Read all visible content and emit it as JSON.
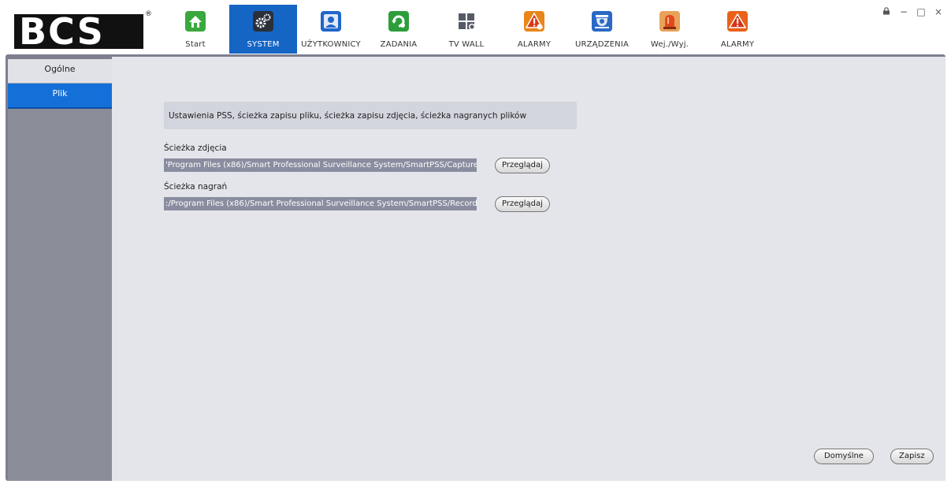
{
  "brand": {
    "logo_text": "BCS",
    "registered_mark": "®"
  },
  "nav": {
    "items": [
      {
        "label": "Start",
        "icon": "home-icon",
        "color": "#3aa83d"
      },
      {
        "label": "SYSTEM",
        "icon": "gear-icon",
        "color": "#2a2f3a"
      },
      {
        "label": "UŻYTKOWNICY",
        "icon": "user-icon",
        "color": "#1f66c9"
      },
      {
        "label": "ZADANIA",
        "icon": "tasks-icon",
        "color": "#2e9e3b"
      },
      {
        "label": "TV WALL",
        "icon": "tv-wall-icon",
        "color": "#555a66"
      },
      {
        "label": "ALARMY",
        "icon": "alarm-warning-icon",
        "color": "#e8861a"
      },
      {
        "label": "URZĄDZENIA",
        "icon": "camera-dome-icon",
        "color": "#2a69c4"
      },
      {
        "label": "Wej./Wyj.",
        "icon": "siren-icon",
        "color": "#e14a1e"
      },
      {
        "label": "ALARMY",
        "icon": "alarm-warning-icon",
        "color": "#e8621a"
      }
    ],
    "active_index": 1,
    "active_color": "#1565c5"
  },
  "window_controls": {
    "lock": "🔒",
    "minimize": "−",
    "maximize": "□",
    "close": "×"
  },
  "sidebar": {
    "items": [
      {
        "label": "Ogólne"
      },
      {
        "label": "Plik"
      }
    ],
    "active_index": 1
  },
  "main": {
    "info": "Ustawienia PSS, ścieżka zapisu pliku, ścieżka zapisu zdjęcia, ścieżka nagranych plików",
    "snapshot_label": "Ścieżka zdjęcia",
    "snapshot_path": "'Program Files (x86)/Smart Professional Surveillance System/SmartPSS/Capture",
    "record_label": "Ścieżka nagrań",
    "record_path": ":/Program Files (x86)/Smart Professional Surveillance System/SmartPSS/Record",
    "browse_label": "Przeglądaj",
    "default_label": "Domyślne",
    "save_label": "Zapisz"
  }
}
